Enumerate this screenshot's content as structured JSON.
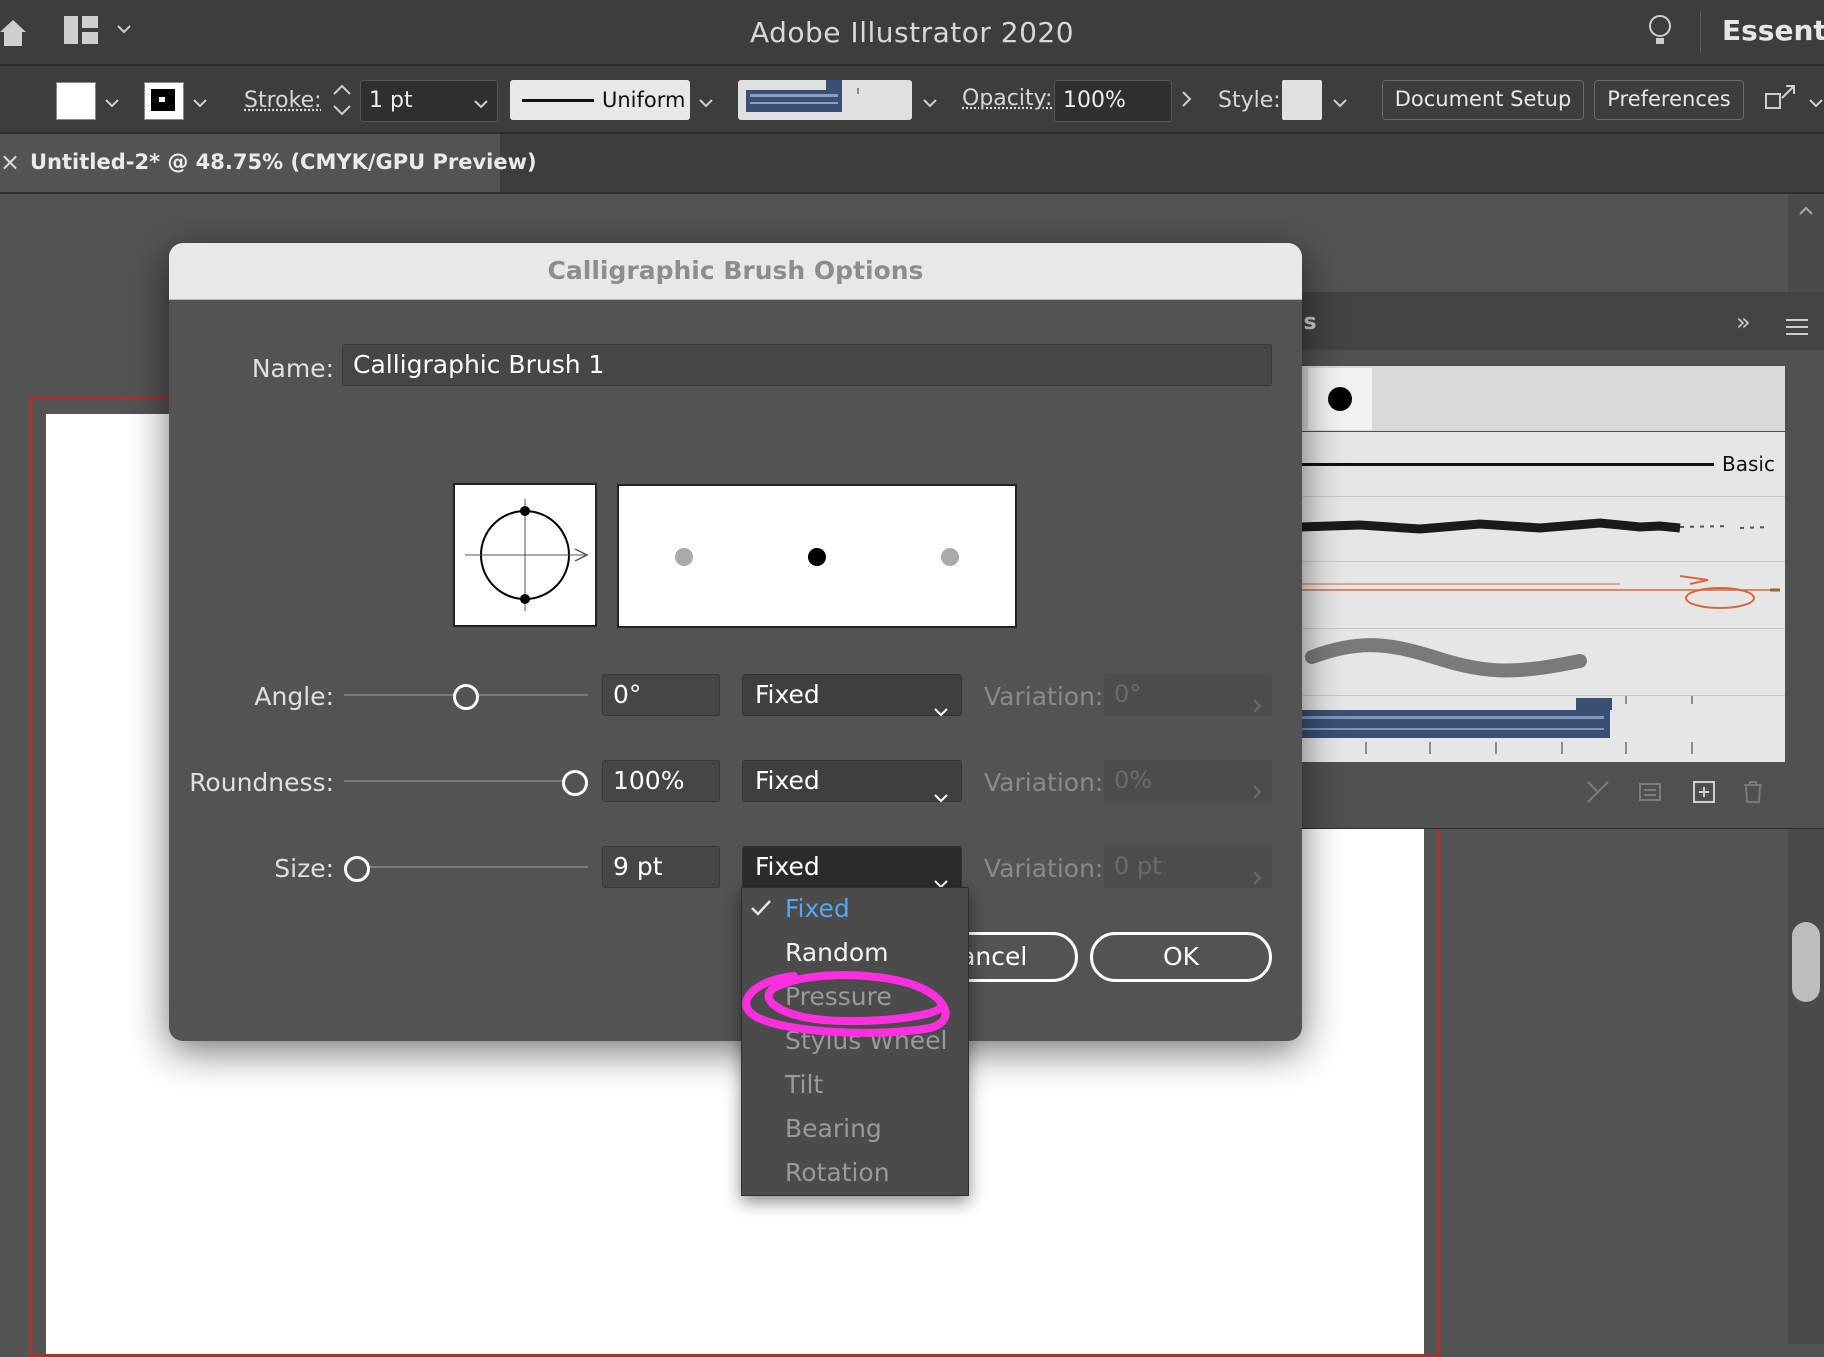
{
  "app": {
    "title": "Adobe Illustrator 2020",
    "workspace": "Essentia"
  },
  "control_bar": {
    "stroke_label": "Stroke:",
    "stroke_weight": "1 pt",
    "stroke_profile": "Uniform",
    "opacity_label": "Opacity:",
    "opacity_value": "100%",
    "style_label": "Style:",
    "document_setup": "Document Setup",
    "preferences": "Preferences"
  },
  "document_tab": {
    "close_glyph": "×",
    "label": "Untitled-2* @ 48.75% (CMYK/GPU Preview)"
  },
  "brush_panel": {
    "partial_title": "ls",
    "collapse_glyph": "»",
    "basic_label": "Basic",
    "colors": {
      "charcoal": "#1a1a1a",
      "arrow_brush": "#d9663a",
      "pattern_brush": "#3a4f73"
    }
  },
  "dialog": {
    "title": "Calligraphic Brush Options",
    "name_label": "Name:",
    "name_value": "Calligraphic Brush 1",
    "rows": [
      {
        "label": "Angle:",
        "value": "0°",
        "mode": "Fixed",
        "variation_label": "Variation:",
        "variation_value": "0°",
        "level": 0.5
      },
      {
        "label": "Roundness:",
        "value": "100%",
        "mode": "Fixed",
        "variation_label": "Variation:",
        "variation_value": "0%",
        "level": 1.0
      },
      {
        "label": "Size:",
        "value": "9 pt",
        "mode": "Fixed",
        "variation_label": "Variation:",
        "variation_value": "0 pt",
        "level": 0.0
      }
    ],
    "cancel_label": "Cancel",
    "ok_label": "OK"
  },
  "dropdown": {
    "items": [
      {
        "label": "Fixed",
        "state": "checked"
      },
      {
        "label": "Random",
        "state": "enabled"
      },
      {
        "label": "Pressure",
        "state": "disabled"
      },
      {
        "label": "Stylus Wheel",
        "state": "disabled"
      },
      {
        "label": "Tilt",
        "state": "disabled"
      },
      {
        "label": "Bearing",
        "state": "disabled"
      },
      {
        "label": "Rotation",
        "state": "disabled"
      }
    ],
    "highlight_color": "#ff2fe0"
  }
}
